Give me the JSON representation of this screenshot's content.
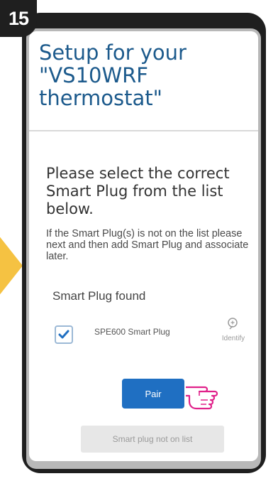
{
  "step": {
    "number": "15"
  },
  "header": {
    "title": "Setup for your \"VS10WRF thermostat\""
  },
  "main": {
    "heading": "Please select the correct Smart Plug from the list below.",
    "description": "If the Smart Plug(s) is not on the list please next and then add Smart Plug and associate later.",
    "found_label": "Smart Plug found",
    "devices": [
      {
        "name": "SPE600 Smart Plug",
        "checked": true,
        "identify_label": "Identify"
      }
    ],
    "pair_label": "Pair",
    "not_on_list_label": "Smart plug not on list"
  },
  "icons": [
    "checkmark-icon",
    "identify-search-icon",
    "pointing-hand-icon",
    "arrow-icon"
  ],
  "colors": {
    "title": "#1c5a8c",
    "primary_button": "#1f6fc2",
    "secondary_button": "#e7e7e7",
    "arrow": "#f5c242",
    "hand": "#e0218a",
    "phone_frame": "#1f1f1f"
  }
}
